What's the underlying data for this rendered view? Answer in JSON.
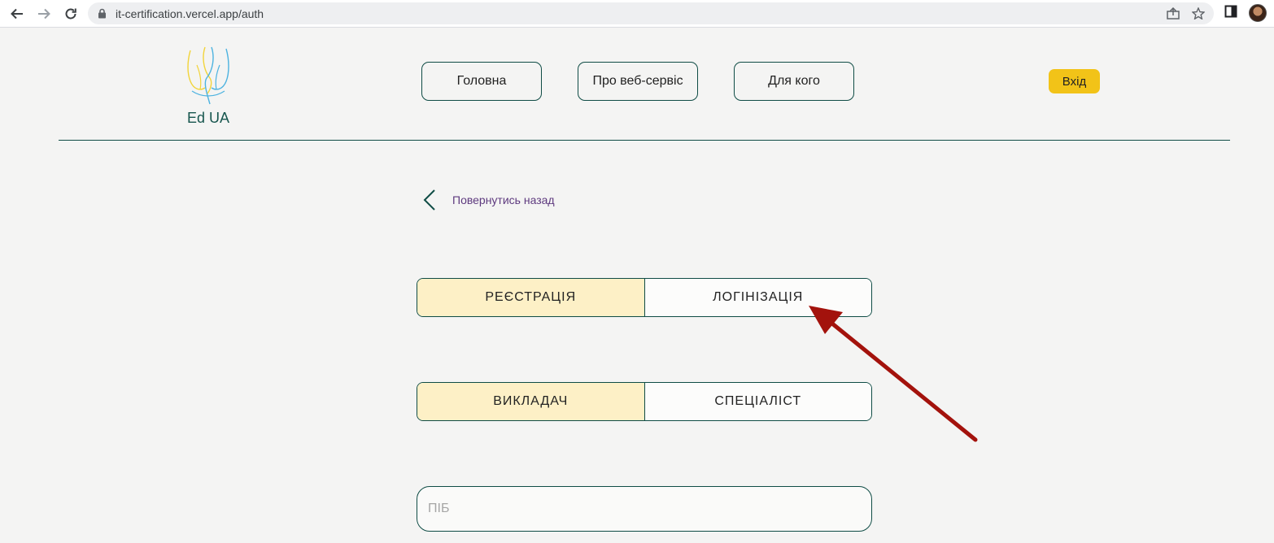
{
  "browser": {
    "url": "it-certification.vercel.app/auth",
    "icons": [
      "back-arrow-icon",
      "forward-arrow-icon",
      "reload-icon",
      "lock-icon",
      "share-icon",
      "star-icon",
      "side-panel-icon",
      "profile-avatar"
    ]
  },
  "header": {
    "logo_text": "Ed UA",
    "nav": [
      {
        "label": "Головна"
      },
      {
        "label": "Про веб-сервіс"
      },
      {
        "label": "Для кого"
      }
    ],
    "login_label": "Вхід"
  },
  "back": {
    "label": "Повернутись назад",
    "icon": "chevron-left-icon"
  },
  "auth_mode": {
    "options": [
      "РЕЄСТРАЦІЯ",
      "ЛОГІНІЗАЦІЯ"
    ],
    "selected": "РЕЄСТРАЦІЯ"
  },
  "role": {
    "options": [
      "ВИКЛАДАЧ",
      "СПЕЦІАЛІСТ"
    ],
    "selected": "ВИКЛАДАЧ"
  },
  "form": {
    "name_placeholder": "ПІБ",
    "name_value": ""
  },
  "colors": {
    "accent": "#0f4c45",
    "login_button": "#f2c318",
    "active_segment": "#fdf0c6",
    "back_link": "#5e3a7f",
    "annotation_arrow": "#a3120c",
    "logo_blue": "#4db3e0",
    "logo_yellow": "#f2d43a"
  }
}
